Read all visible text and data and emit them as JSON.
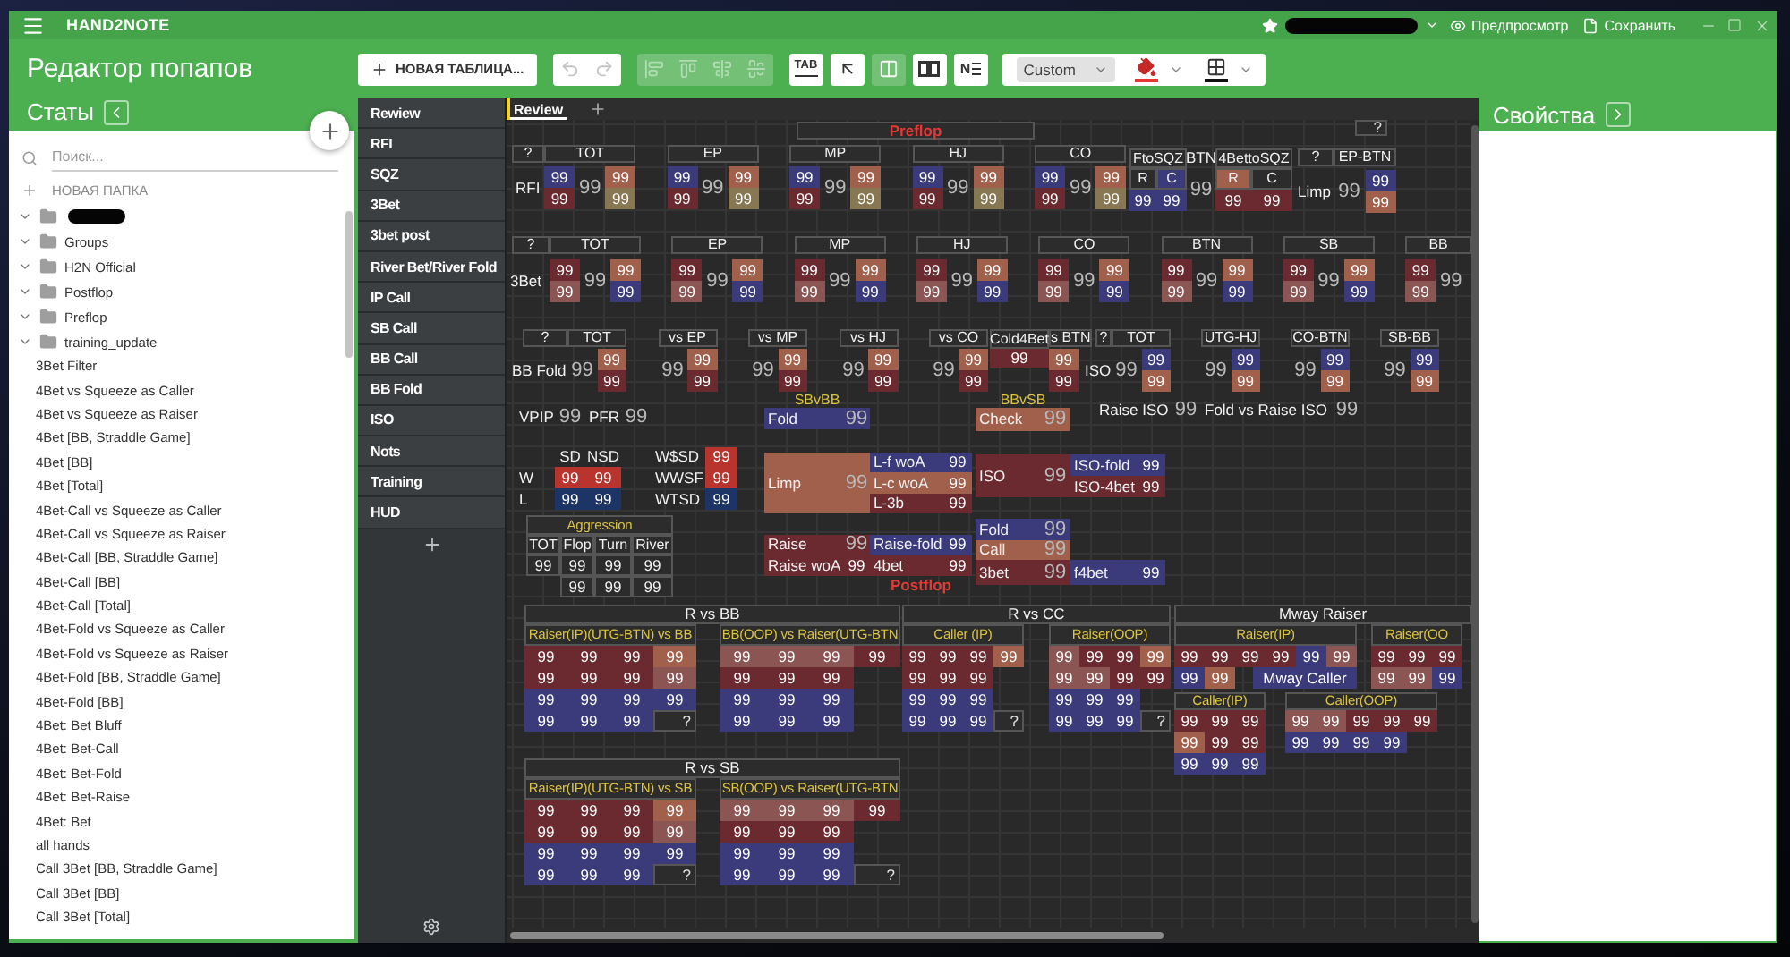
{
  "title_bar": {
    "app_name": "HAND2NOTE",
    "actions": [
      {
        "kind": "preview",
        "label": "Предпросмотр"
      },
      {
        "kind": "save",
        "label": "Сохранить"
      }
    ]
  },
  "stats_panel": {
    "title": "Редактор попапов",
    "heading": "Статы",
    "search": {
      "placeholder": "Поиск..."
    },
    "new_folder": "НОВАЯ ПАПКА",
    "folders": [
      {
        "redacted": true
      },
      {
        "name": "Groups",
        "redacted": false
      },
      {
        "name": "H2N Official",
        "redacted": false
      },
      {
        "name": "Postflop",
        "redacted": false
      },
      {
        "name": "Preflop",
        "redacted": false
      },
      {
        "name": "training_update",
        "redacted": false
      }
    ],
    "stats": [
      "3Bet Filter",
      "4Bet vs Squeeze as Caller",
      "4Bet vs Squeeze as Raiser",
      "4Bet [BB, Straddle Game]",
      "4Bet [BB]",
      "4Bet [Total]",
      "4Bet-Call vs Squeeze as Caller",
      "4Bet-Call vs Squeeze as Raiser",
      "4Bet-Call [BB, Straddle Game]",
      "4Bet-Call [BB]",
      "4Bet-Call [Total]",
      "4Bet-Fold vs Squeeze as Caller",
      "4Bet-Fold vs Squeeze as Raiser",
      "4Bet-Fold [BB, Straddle Game]",
      "4Bet-Fold [BB]",
      "4Bet: Bet Bluff",
      "4Bet: Bet-Call",
      "4Bet: Bet-Fold",
      "4Bet: Bet-Raise",
      "4Bet: Bet",
      "all hands",
      "Call 3Bet [BB, Straddle Game]",
      "Call 3Bet [BB]",
      "Call 3Bet [Total]"
    ]
  },
  "toolbar": {
    "new_table": "НОВАЯ ТАБЛИЦА...",
    "groups": [
      {
        "kind": "solid",
        "buttons": [
          {
            "kind": "undo",
            "disabled": true
          },
          {
            "kind": "redo",
            "disabled": true
          }
        ]
      },
      {
        "kind": "flat",
        "buttons": [
          {
            "kind": "align_left",
            "disabled": true
          },
          {
            "kind": "align_top",
            "disabled": true
          },
          {
            "kind": "align_center",
            "disabled": true
          },
          {
            "kind": "align_middle",
            "disabled": true
          }
        ]
      },
      {
        "kind": "solid",
        "buttons": [
          {
            "kind": "tab",
            "label": "TAB",
            "disabled": false
          }
        ]
      },
      {
        "kind": "solid",
        "buttons": [
          {
            "kind": "arrow",
            "disabled": false
          }
        ]
      },
      {
        "kind": "flat",
        "buttons": [
          {
            "kind": "columns",
            "disabled": false
          }
        ]
      },
      {
        "kind": "solid",
        "buttons": [
          {
            "kind": "panels",
            "disabled": false
          }
        ]
      },
      {
        "kind": "solid",
        "buttons": [
          {
            "kind": "numbering",
            "label": "N",
            "disabled": false
          }
        ]
      }
    ],
    "format": {
      "style": "Custom"
    }
  },
  "popups": [
    "Rewiew",
    "RFI",
    "SQZ",
    "3Bet",
    "3bet post",
    "River Bet/River Fold",
    "IP Call",
    "SB Call",
    "BB Call",
    "BB Fold",
    "ISO",
    "Nots",
    "Training",
    "HUD"
  ],
  "editor": {
    "tabs": [
      {
        "label": "Review",
        "selected": true
      }
    ],
    "blocks": [
      {
        "kind": "table",
        "rows": [
          [
            {
              "text": "Preflop"
            }
          ]
        ]
      },
      {
        "kind": "table",
        "rows": [
          [
            {
              "text": "?"
            }
          ]
        ]
      },
      {
        "kind": "cluster",
        "corner": "?",
        "label": "RFI",
        "positions": [
          {
            "name": "TOT",
            "values": [
              {
                "text": "99",
                "color": "#3b3a7a"
              },
              {
                "text": "99",
                "color": "#6b2a30"
              },
              {
                "text": "99"
              },
              {
                "text": "99",
                "color": "#a0604b"
              },
              {
                "text": "99",
                "color": "#877752"
              }
            ]
          },
          {
            "name": "EP",
            "values": [
              {
                "text": "99",
                "color": "#3b3a7a"
              },
              {
                "text": "99",
                "color": "#6b2a30"
              },
              {
                "text": "99"
              },
              {
                "text": "99",
                "color": "#a0604b"
              },
              {
                "text": "99",
                "color": "#877752"
              }
            ]
          },
          {
            "name": "MP",
            "values": [
              {
                "text": "99",
                "color": "#3b3a7a"
              },
              {
                "text": "99",
                "color": "#6b2a30"
              },
              {
                "text": "99"
              },
              {
                "text": "99",
                "color": "#a0604b"
              },
              {
                "text": "99",
                "color": "#877752"
              }
            ]
          },
          {
            "name": "HJ",
            "values": [
              {
                "text": "99",
                "color": "#3b3a7a"
              },
              {
                "text": "99",
                "color": "#6b2a30"
              },
              {
                "text": "99"
              },
              {
                "text": "99",
                "color": "#a0604b"
              },
              {
                "text": "99",
                "color": "#877752"
              }
            ]
          },
          {
            "name": "CO",
            "values": [
              {
                "text": "99",
                "color": "#3b3a7a"
              },
              {
                "text": "99",
                "color": "#6b2a30"
              },
              {
                "text": "99"
              },
              {
                "text": "99",
                "color": "#a0604b"
              },
              {
                "text": "99",
                "color": "#877752"
              }
            ]
          }
        ]
      },
      {
        "kind": "table",
        "rows": [
          [
            {
              "text": "FtoSQZ",
              "colspan": 2
            },
            {
              "text": "BTN"
            },
            {
              "text": "4BettoSQZ",
              "colspan": 2
            }
          ],
          [
            {
              "text": "R"
            },
            {
              "text": "C",
              "color": "#3b3a7a"
            },
            {
              "text": "99",
              "rowspan": 2
            },
            {
              "text": "R",
              "color": "#a0604b"
            },
            {
              "text": "C"
            }
          ],
          [
            {
              "text": "99",
              "color": "#3b3a7a"
            },
            {
              "text": "99",
              "color": "#3b3a7a"
            },
            {
              "text": "99",
              "color": "#6b2a30"
            },
            {
              "text": "99",
              "color": "#6b2a30"
            }
          ]
        ]
      },
      {
        "kind": "cluster",
        "corner": "?",
        "label": "Limp",
        "positions": [
          {
            "name": "EP-BTN",
            "values": [
              {
                "text": "99"
              },
              {
                "text": "99",
                "color": "#3b3a7a"
              },
              {
                "text": "99",
                "color": "#a0604b"
              }
            ]
          }
        ]
      },
      {
        "kind": "cluster",
        "corner": "?",
        "label": "3Bet",
        "positions": [
          {
            "name": "TOT",
            "values": [
              {
                "text": "99",
                "color": "#6b2a30"
              },
              {
                "text": "99",
                "color": "#8a5553"
              },
              {
                "text": "99"
              },
              {
                "text": "99",
                "color": "#a0604b"
              },
              {
                "text": "99",
                "color": "#3b3a7a"
              }
            ]
          },
          {
            "name": "EP",
            "values": [
              {
                "text": "99",
                "color": "#6b2a30"
              },
              {
                "text": "99",
                "color": "#8a5553"
              },
              {
                "text": "99"
              },
              {
                "text": "99",
                "color": "#a0604b"
              },
              {
                "text": "99",
                "color": "#3b3a7a"
              }
            ]
          },
          {
            "name": "MP",
            "values": [
              {
                "text": "99",
                "color": "#6b2a30"
              },
              {
                "text": "99",
                "color": "#8a5553"
              },
              {
                "text": "99"
              },
              {
                "text": "99",
                "color": "#a0604b"
              },
              {
                "text": "99",
                "color": "#3b3a7a"
              }
            ]
          },
          {
            "name": "HJ",
            "values": [
              {
                "text": "99",
                "color": "#6b2a30"
              },
              {
                "text": "99",
                "color": "#8a5553"
              },
              {
                "text": "99"
              },
              {
                "text": "99",
                "color": "#a0604b"
              },
              {
                "text": "99",
                "color": "#3b3a7a"
              }
            ]
          },
          {
            "name": "CO",
            "values": [
              {
                "text": "99",
                "color": "#6b2a30"
              },
              {
                "text": "99",
                "color": "#8a5553"
              },
              {
                "text": "99"
              },
              {
                "text": "99",
                "color": "#a0604b"
              },
              {
                "text": "99",
                "color": "#3b3a7a"
              }
            ]
          },
          {
            "name": "BTN",
            "values": [
              {
                "text": "99",
                "color": "#6b2a30"
              },
              {
                "text": "99",
                "color": "#8a5553"
              },
              {
                "text": "99"
              },
              {
                "text": "99",
                "color": "#a0604b"
              },
              {
                "text": "99",
                "color": "#3b3a7a"
              }
            ]
          },
          {
            "name": "SB",
            "values": [
              {
                "text": "99",
                "color": "#6b2a30"
              },
              {
                "text": "99",
                "color": "#8a5553"
              },
              {
                "text": "99"
              },
              {
                "text": "99",
                "color": "#a0604b"
              },
              {
                "text": "99",
                "color": "#3b3a7a"
              }
            ]
          },
          {
            "name": "BB",
            "values": [
              {
                "text": "99",
                "color": "#6b2a30"
              },
              {
                "text": "99",
                "color": "#8a5553"
              },
              {
                "text": "99"
              }
            ]
          }
        ]
      },
      {
        "kind": "cluster",
        "corner": "?",
        "label": "BB Fold",
        "positions": [
          {
            "name": "TOT",
            "values": [
              {
                "text": "99"
              },
              {
                "text": "99",
                "color": "#a0604b"
              },
              {
                "text": "99",
                "color": "#6b2a30"
              }
            ]
          },
          {
            "name": "vs EP",
            "values": [
              {
                "text": "99"
              },
              {
                "text": "99",
                "color": "#a0604b"
              },
              {
                "text": "99",
                "color": "#6b2a30"
              }
            ]
          },
          {
            "name": "vs MP",
            "values": [
              {
                "text": "99"
              },
              {
                "text": "99",
                "color": "#a0604b"
              },
              {
                "text": "99",
                "color": "#6b2a30"
              }
            ]
          },
          {
            "name": "vs HJ",
            "values": [
              {
                "text": "99"
              },
              {
                "text": "99",
                "color": "#a0604b"
              },
              {
                "text": "99",
                "color": "#6b2a30"
              }
            ]
          },
          {
            "name": "vs CO",
            "values": [
              {
                "text": "99"
              },
              {
                "text": "99",
                "color": "#a0604b"
              },
              {
                "text": "99",
                "color": "#6b2a30"
              }
            ]
          },
          {
            "name": "s BTN",
            "values": [
              {
                "text": "99",
                "color": "#a0604b"
              },
              {
                "text": "99",
                "color": "#6b2a30"
              }
            ]
          }
        ]
      },
      {
        "kind": "table",
        "rows": [
          [
            {
              "text": "Cold4Bet"
            }
          ],
          [
            {
              "text": "99",
              "color": "#6b2a30"
            }
          ]
        ]
      },
      {
        "kind": "cluster",
        "corner": "?",
        "label": "ISO",
        "positions": [
          {
            "name": "TOT",
            "values": [
              {
                "text": "99"
              },
              {
                "text": "99",
                "color": "#3b3a7a"
              },
              {
                "text": "99",
                "color": "#a0604b"
              }
            ]
          },
          {
            "name": "UTG-HJ",
            "values": [
              {
                "text": "99"
              },
              {
                "text": "99",
                "color": "#3b3a7a"
              },
              {
                "text": "99",
                "color": "#a0604b"
              }
            ]
          },
          {
            "name": "CO-BTN",
            "values": [
              {
                "text": "99"
              },
              {
                "text": "99",
                "color": "#3b3a7a"
              },
              {
                "text": "99",
                "color": "#a0604b"
              }
            ]
          },
          {
            "name": "SB-BB",
            "values": [
              {
                "text": "99"
              },
              {
                "text": "99",
                "color": "#3b3a7a"
              },
              {
                "text": "99",
                "color": "#a0604b"
              }
            ]
          }
        ]
      },
      {
        "kind": "table",
        "rows": [
          [
            {
              "text": "VPIP"
            },
            {
              "text": "99"
            },
            {
              "text": "PFR"
            },
            {
              "text": "99"
            }
          ],
          [
            {
              "text": ""
            },
            {
              "text": "SD"
            },
            {
              "text": "NSD"
            },
            {
              "text": ""
            },
            {
              "text": "W$SD"
            },
            {
              "text": "99",
              "color": "#b8342c"
            }
          ],
          [
            {
              "text": "W"
            },
            {
              "text": "99",
              "color": "#b8342c"
            },
            {
              "text": "99",
              "color": "#b8342c"
            },
            {
              "text": ""
            },
            {
              "text": "WWSF"
            },
            {
              "text": "99",
              "color": "#b8342c"
            }
          ],
          [
            {
              "text": "L"
            },
            {
              "text": "99",
              "color": "#1d3566"
            },
            {
              "text": "99",
              "color": "#1d3566"
            },
            {
              "text": ""
            },
            {
              "text": "WTSD"
            },
            {
              "text": "99",
              "color": "#1d3566"
            }
          ]
        ]
      },
      {
        "kind": "table",
        "rows": [
          [
            {
              "text": "Aggression",
              "colspan": 4
            }
          ],
          [
            {
              "text": "TOT"
            },
            {
              "text": "Flop"
            },
            {
              "text": "Turn"
            },
            {
              "text": "River"
            }
          ],
          [
            {
              "text": "99"
            },
            {
              "text": "99"
            },
            {
              "text": "99"
            },
            {
              "text": "99"
            }
          ],
          [
            {
              "text": ""
            },
            {
              "text": "99"
            },
            {
              "text": "99"
            },
            {
              "text": "99"
            }
          ]
        ]
      },
      {
        "kind": "table",
        "rows": [
          [
            {
              "text": "SBvBB",
              "colspan": 2
            }
          ],
          [
            {
              "text": "Fold",
              "color": "#3b3a7a"
            },
            {
              "text": "99",
              "color": "#3b3a7a"
            }
          ],
          [
            {
              "text": "Limp",
              "color": "#a0604b",
              "rowspan": 3
            },
            {
              "text": "99",
              "color": "#a0604b",
              "rowspan": 3
            },
            {
              "text": "L-f woA",
              "color": "#3b3a7a"
            },
            {
              "text": "99",
              "color": "#3b3a7a"
            }
          ],
          [
            {
              "text": "L-c woA",
              "color": "#a0604b"
            },
            {
              "text": "99",
              "color": "#a0604b"
            }
          ],
          [
            {
              "text": "L-3b",
              "color": "#6b2a30"
            },
            {
              "text": "99",
              "color": "#6b2a30"
            }
          ],
          [
            {
              "text": "Raise",
              "color": "#6b2a30"
            },
            {
              "text": "99",
              "color": "#6b2a30"
            },
            {
              "text": "Raise-fold",
              "color": "#3b3a7a"
            },
            {
              "text": "99",
              "color": "#3b3a7a"
            }
          ],
          [
            {
              "text": "Raise woA",
              "color": "#6b2a30"
            },
            {
              "text": "99",
              "color": "#6b2a30"
            },
            {
              "text": "4bet",
              "color": "#6b2a30"
            },
            {
              "text": "99",
              "color": "#6b2a30"
            }
          ],
          [
            {
              "text": ""
            },
            {
              "text": ""
            },
            {
              "text": "Postflop",
              "colspan": 2
            }
          ]
        ]
      },
      {
        "kind": "table",
        "rows": [
          [
            {
              "text": "BBvSB",
              "colspan": 2
            }
          ],
          [
            {
              "text": "Check",
              "color": "#a0604b"
            },
            {
              "text": "99",
              "color": "#a0604b"
            }
          ],
          [
            {
              "text": "ISO",
              "color": "#6b2a30",
              "rowspan": 2
            },
            {
              "text": "99",
              "color": "#6b2a30",
              "rowspan": 2
            },
            {
              "text": "ISO-fold",
              "color": "#3b3a7a"
            },
            {
              "text": "99",
              "color": "#3b3a7a"
            }
          ],
          [
            {
              "text": "ISO-4bet",
              "color": "#6b2a30"
            },
            {
              "text": "99",
              "color": "#6b2a30"
            }
          ],
          [
            {
              "text": "Fold",
              "color": "#3b3a7a"
            },
            {
              "text": "99",
              "color": "#3b3a7a"
            }
          ],
          [
            {
              "text": "Call",
              "color": "#a0604b"
            },
            {
              "text": "99",
              "color": "#a0604b"
            }
          ],
          [
            {
              "text": "3bet",
              "color": "#6b2a30"
            },
            {
              "text": "99",
              "color": "#6b2a30"
            },
            {
              "text": "f4bet",
              "color": "#3b3a7a"
            },
            {
              "text": "99",
              "color": "#3b3a7a"
            }
          ]
        ]
      },
      {
        "kind": "table",
        "rows": [
          [
            {
              "text": "Raise ISO"
            },
            {
              "text": "99"
            },
            {
              "text": "Fold vs Raise ISO"
            },
            {
              "text": "99"
            }
          ]
        ]
      },
      {
        "kind": "table",
        "rows": [
          [
            {
              "text": "R vs BB"
            }
          ]
        ]
      },
      {
        "kind": "table",
        "rows": [
          [
            {
              "text": "Raiser(IP)(UTG-BTN) vs BB",
              "colspan": 4
            }
          ],
          [
            {
              "text": "99",
              "color": "#6b2a30"
            },
            {
              "text": "99",
              "color": "#6b2a30"
            },
            {
              "text": "99",
              "color": "#6b2a30"
            },
            {
              "text": "99",
              "color": "#a0604b"
            }
          ],
          [
            {
              "text": "99",
              "color": "#6b2a30"
            },
            {
              "text": "99",
              "color": "#6b2a30"
            },
            {
              "text": "99",
              "color": "#6b2a30"
            },
            {
              "text": "99",
              "color": "#8a5553"
            }
          ],
          [
            {
              "text": "99",
              "color": "#3b3a7a"
            },
            {
              "text": "99",
              "color": "#3b3a7a"
            },
            {
              "text": "99",
              "color": "#3b3a7a"
            },
            {
              "text": "99",
              "color": "#3b3a7a"
            }
          ],
          [
            {
              "text": "99",
              "color": "#3b3a7a"
            },
            {
              "text": "99",
              "color": "#3b3a7a"
            },
            {
              "text": "99",
              "color": "#3b3a7a"
            },
            {
              "text": "?"
            }
          ]
        ]
      },
      {
        "kind": "table",
        "rows": [
          [
            {
              "text": "BB(OOP) vs Raiser(UTG-BTN",
              "colspan": 4
            }
          ],
          [
            {
              "text": "99",
              "color": "#8a5553"
            },
            {
              "text": "99",
              "color": "#8a5553"
            },
            {
              "text": "99",
              "color": "#8a5553"
            },
            {
              "text": "99",
              "color": "#6b2a30"
            }
          ],
          [
            {
              "text": "99",
              "color": "#6b2a30"
            },
            {
              "text": "99",
              "color": "#6b2a30"
            },
            {
              "text": "99",
              "color": "#6b2a30"
            }
          ],
          [
            {
              "text": "99",
              "color": "#3b3a7a"
            },
            {
              "text": "99",
              "color": "#3b3a7a"
            },
            {
              "text": "99",
              "color": "#3b3a7a"
            }
          ],
          [
            {
              "text": "99",
              "color": "#3b3a7a"
            },
            {
              "text": "99",
              "color": "#3b3a7a"
            },
            {
              "text": "99",
              "color": "#3b3a7a"
            }
          ]
        ]
      },
      {
        "kind": "table",
        "rows": [
          [
            {
              "text": "R vs CC"
            }
          ]
        ]
      },
      {
        "kind": "table",
        "rows": [
          [
            {
              "text": "Caller (IP)",
              "colspan": 4
            }
          ],
          [
            {
              "text": "99",
              "color": "#6b2a30"
            },
            {
              "text": "99",
              "color": "#6b2a30"
            },
            {
              "text": "99",
              "color": "#6b2a30"
            },
            {
              "text": "99",
              "color": "#a0604b"
            }
          ],
          [
            {
              "text": "99",
              "color": "#6b2a30"
            },
            {
              "text": "99",
              "color": "#6b2a30"
            },
            {
              "text": "99",
              "color": "#6b2a30"
            }
          ],
          [
            {
              "text": "99",
              "color": "#3b3a7a"
            },
            {
              "text": "99",
              "color": "#3b3a7a"
            },
            {
              "text": "99",
              "color": "#3b3a7a"
            }
          ],
          [
            {
              "text": "99",
              "color": "#3b3a7a"
            },
            {
              "text": "99",
              "color": "#3b3a7a"
            },
            {
              "text": "99",
              "color": "#3b3a7a"
            },
            {
              "text": "?"
            }
          ]
        ]
      },
      {
        "kind": "table",
        "rows": [
          [
            {
              "text": "Raiser(OOP)",
              "colspan": 4
            }
          ],
          [
            {
              "text": "99",
              "color": "#8a5553"
            },
            {
              "text": "99",
              "color": "#6b2a30"
            },
            {
              "text": "99",
              "color": "#6b2a30"
            },
            {
              "text": "99",
              "color": "#a0604b"
            }
          ],
          [
            {
              "text": "99",
              "color": "#8a5553"
            },
            {
              "text": "99",
              "color": "#8a5553"
            },
            {
              "text": "99",
              "color": "#6b2a30"
            },
            {
              "text": "99",
              "color": "#6b2a30"
            }
          ],
          [
            {
              "text": "99",
              "color": "#3b3a7a"
            },
            {
              "text": "99",
              "color": "#3b3a7a"
            },
            {
              "text": "99",
              "color": "#3b3a7a"
            }
          ],
          [
            {
              "text": "99",
              "color": "#3b3a7a"
            },
            {
              "text": "99",
              "color": "#3b3a7a"
            },
            {
              "text": "99",
              "color": "#3b3a7a"
            },
            {
              "text": "?"
            }
          ]
        ]
      },
      {
        "kind": "table",
        "rows": [
          [
            {
              "text": "Mway Raiser"
            }
          ]
        ]
      },
      {
        "kind": "table",
        "rows": [
          [
            {
              "text": "Raiser(IP)",
              "colspan": 6
            }
          ],
          [
            {
              "text": "99",
              "color": "#6b2a30"
            },
            {
              "text": "99",
              "color": "#6b2a30"
            },
            {
              "text": "99",
              "color": "#6b2a30"
            },
            {
              "text": "99",
              "color": "#6b2a30"
            },
            {
              "text": "99",
              "color": "#3b3a7a"
            },
            {
              "text": "99",
              "color": "#8a5553"
            }
          ],
          [
            {
              "text": "99",
              "color": "#3b3a7a"
            },
            {
              "text": "99",
              "color": "#a0604b"
            }
          ]
        ]
      },
      {
        "kind": "table",
        "rows": [
          [
            {
              "text": "Mway Caller",
              "color": "#3b3a7a"
            }
          ]
        ]
      },
      {
        "kind": "table",
        "rows": [
          [
            {
              "text": "Raiser(OO",
              "colspan": 3
            }
          ],
          [
            {
              "text": "99",
              "color": "#6b2a30"
            },
            {
              "text": "99",
              "color": "#6b2a30"
            },
            {
              "text": "99",
              "color": "#6b2a30"
            }
          ],
          [
            {
              "text": "99",
              "color": "#8a5553"
            },
            {
              "text": "99",
              "color": "#8a5553"
            },
            {
              "text": "99",
              "color": "#3b3a7a"
            }
          ]
        ]
      },
      {
        "kind": "table",
        "rows": [
          [
            {
              "text": "Caller(IP)",
              "colspan": 3
            }
          ],
          [
            {
              "text": "99",
              "color": "#6b2a30"
            },
            {
              "text": "99",
              "color": "#6b2a30"
            },
            {
              "text": "99",
              "color": "#6b2a30"
            }
          ],
          [
            {
              "text": "99",
              "color": "#a0604b"
            },
            {
              "text": "99",
              "color": "#6b2a30"
            },
            {
              "text": "99",
              "color": "#6b2a30"
            }
          ],
          [
            {
              "text": "99",
              "color": "#3b3a7a"
            },
            {
              "text": "99",
              "color": "#3b3a7a"
            },
            {
              "text": "99",
              "color": "#3b3a7a"
            }
          ]
        ]
      },
      {
        "kind": "table",
        "rows": [
          [
            {
              "text": "Caller(OOP)",
              "colspan": 5
            }
          ],
          [
            {
              "text": "99",
              "color": "#8a5553"
            },
            {
              "text": "99",
              "color": "#8a5553"
            },
            {
              "text": "99",
              "color": "#6b2a30"
            },
            {
              "text": "99",
              "color": "#6b2a30"
            },
            {
              "text": "99",
              "color": "#6b2a30"
            }
          ],
          [
            {
              "text": "99",
              "color": "#3b3a7a"
            },
            {
              "text": "99",
              "color": "#3b3a7a"
            },
            {
              "text": "99",
              "color": "#3b3a7a"
            },
            {
              "text": "99",
              "color": "#3b3a7a"
            }
          ]
        ]
      },
      {
        "kind": "table",
        "rows": [
          [
            {
              "text": "R vs SB"
            }
          ]
        ]
      },
      {
        "kind": "table",
        "rows": [
          [
            {
              "text": "Raiser(IP)(UTG-BTN) vs SB",
              "colspan": 4
            }
          ],
          [
            {
              "text": "99",
              "color": "#6b2a30"
            },
            {
              "text": "99",
              "color": "#6b2a30"
            },
            {
              "text": "99",
              "color": "#6b2a30"
            },
            {
              "text": "99",
              "color": "#a0604b"
            }
          ],
          [
            {
              "text": "99",
              "color": "#6b2a30"
            },
            {
              "text": "99",
              "color": "#6b2a30"
            },
            {
              "text": "99",
              "color": "#6b2a30"
            },
            {
              "text": "99",
              "color": "#8a5553"
            }
          ],
          [
            {
              "text": "99",
              "color": "#3b3a7a"
            },
            {
              "text": "99",
              "color": "#3b3a7a"
            },
            {
              "text": "99",
              "color": "#3b3a7a"
            },
            {
              "text": "99",
              "color": "#3b3a7a"
            }
          ],
          [
            {
              "text": "99",
              "color": "#3b3a7a"
            },
            {
              "text": "99",
              "color": "#3b3a7a"
            },
            {
              "text": "99",
              "color": "#3b3a7a"
            },
            {
              "text": "?"
            }
          ]
        ]
      },
      {
        "kind": "table",
        "rows": [
          [
            {
              "text": "SB(OOP) vs Raiser(UTG-BTN",
              "colspan": 4
            }
          ],
          [
            {
              "text": "99",
              "color": "#8a5553"
            },
            {
              "text": "99",
              "color": "#8a5553"
            },
            {
              "text": "99",
              "color": "#8a5553"
            },
            {
              "text": "99",
              "color": "#6b2a30"
            }
          ],
          [
            {
              "text": "99",
              "color": "#6b2a30"
            },
            {
              "text": "99",
              "color": "#6b2a30"
            },
            {
              "text": "99",
              "color": "#6b2a30"
            }
          ],
          [
            {
              "text": "99",
              "color": "#3b3a7a"
            },
            {
              "text": "99",
              "color": "#3b3a7a"
            },
            {
              "text": "99",
              "color": "#3b3a7a"
            }
          ],
          [
            {
              "text": "99",
              "color": "#3b3a7a"
            },
            {
              "text": "99",
              "color": "#3b3a7a"
            },
            {
              "text": "99",
              "color": "#3b3a7a"
            },
            {
              "text": "?"
            }
          ]
        ]
      }
    ]
  },
  "properties_panel": {
    "title": "Свойства"
  }
}
